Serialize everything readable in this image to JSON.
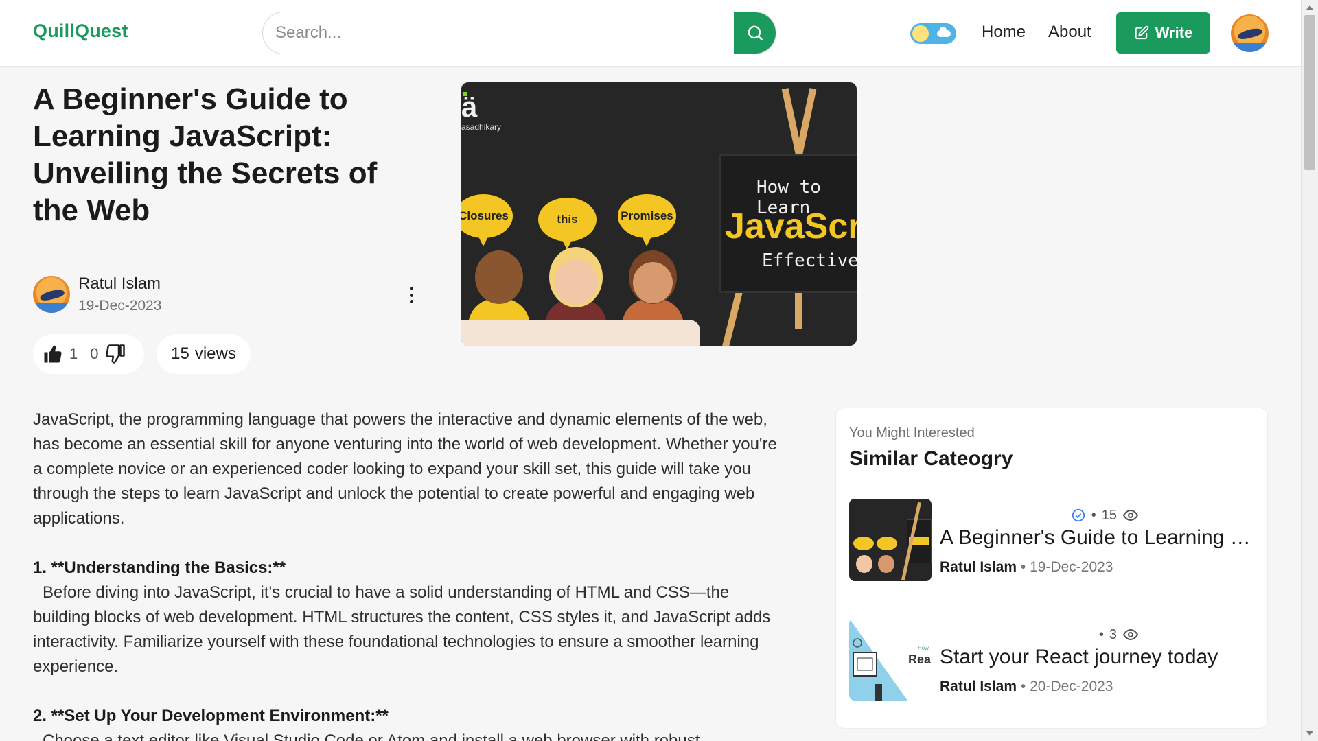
{
  "app": {
    "logo": "QuillQuest"
  },
  "header": {
    "search_placeholder": "Search...",
    "nav": {
      "home": "Home",
      "about": "About"
    },
    "write_label": "Write"
  },
  "article": {
    "title": "A Beginner's Guide to Learning JavaScript: Unveiling the Secrets of the Web",
    "author": "Ratul Islam",
    "date": "19-Dec-2023",
    "likes": "1",
    "dislikes": "0",
    "views_count": "15",
    "views_label": "views",
    "cover": {
      "brand_letter": "ä",
      "brand_name": "asadhikary",
      "bubbles": [
        "Closures",
        "this",
        "Promises"
      ],
      "board_line1": "How to Learn",
      "board_line2": "JavaScrip",
      "board_line3": "Effectively"
    },
    "paragraphs": {
      "intro": "JavaScript, the programming language that powers the interactive and dynamic elements of the web, has become an essential skill for anyone venturing into the world of web development. Whether you're a complete novice or an experienced coder looking to expand your skill set, this guide will take you through the steps to learn JavaScript and unlock the potential to create powerful and engaging web applications.",
      "h1": "1. **Understanding the Basics:**",
      "p1": "Before diving into JavaScript, it's crucial to have a solid understanding of HTML and CSS—the building blocks of web development. HTML structures the content, CSS styles it, and JavaScript adds interactivity. Familiarize yourself with these foundational technologies to ensure a smoother learning experience.",
      "h2": "2. **Set Up Your Development Environment:**",
      "p2": "Choose a text editor like Visual Studio Code or Atom and install a web browser with robust"
    }
  },
  "sidebar": {
    "kicker": "You Might Interested",
    "title": "Similar Cateogry",
    "cards": [
      {
        "views": "15",
        "title": "A Beginner's Guide to Learning JavaScript: Unveiling the Secrets of the Web",
        "author": "Ratul Islam",
        "date": "19-Dec-2023"
      },
      {
        "views": "3",
        "title": "Start your React journey today",
        "author": "Ratul Islam",
        "date": "20-Dec-2023"
      }
    ]
  },
  "colors": {
    "brand": "#1a9a5c",
    "text": "#1f1f1f",
    "muted": "#6f6f6f",
    "page_bg": "#f6f6f6"
  }
}
